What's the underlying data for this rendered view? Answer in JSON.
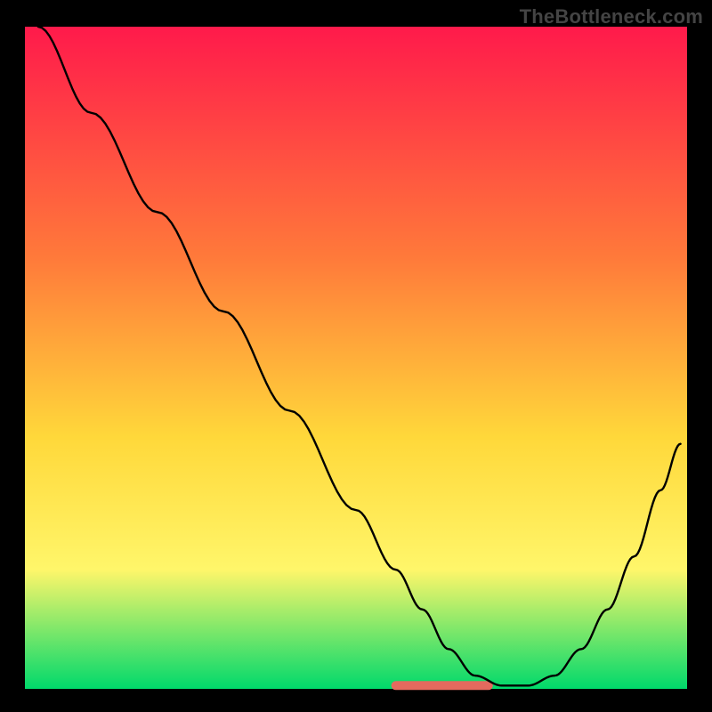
{
  "watermark": "TheBottleneck.com",
  "colors": {
    "black": "#000000",
    "curve": "#000000",
    "highlight": "#e46a5e",
    "grad_top": "#ff1a4b",
    "grad_mid_upper": "#ff7a3a",
    "grad_mid": "#ffd83a",
    "grad_low": "#fff66a",
    "grad_green": "#00d96b"
  },
  "chart_data": {
    "type": "line",
    "title": "",
    "xlabel": "",
    "ylabel": "",
    "xlim": [
      0,
      100
    ],
    "ylim": [
      0,
      100
    ],
    "x": [
      2,
      10,
      20,
      30,
      40,
      50,
      56,
      60,
      64,
      68,
      72,
      76,
      80,
      84,
      88,
      92,
      96,
      99
    ],
    "values": [
      100,
      87,
      72,
      57,
      42,
      27,
      18,
      12,
      6,
      2,
      0.5,
      0.5,
      2,
      6,
      12,
      20,
      30,
      37
    ],
    "highlight_band_x": [
      56,
      70
    ],
    "highlight_y": 0.5,
    "grid": false,
    "legend": false,
    "annotations": []
  }
}
